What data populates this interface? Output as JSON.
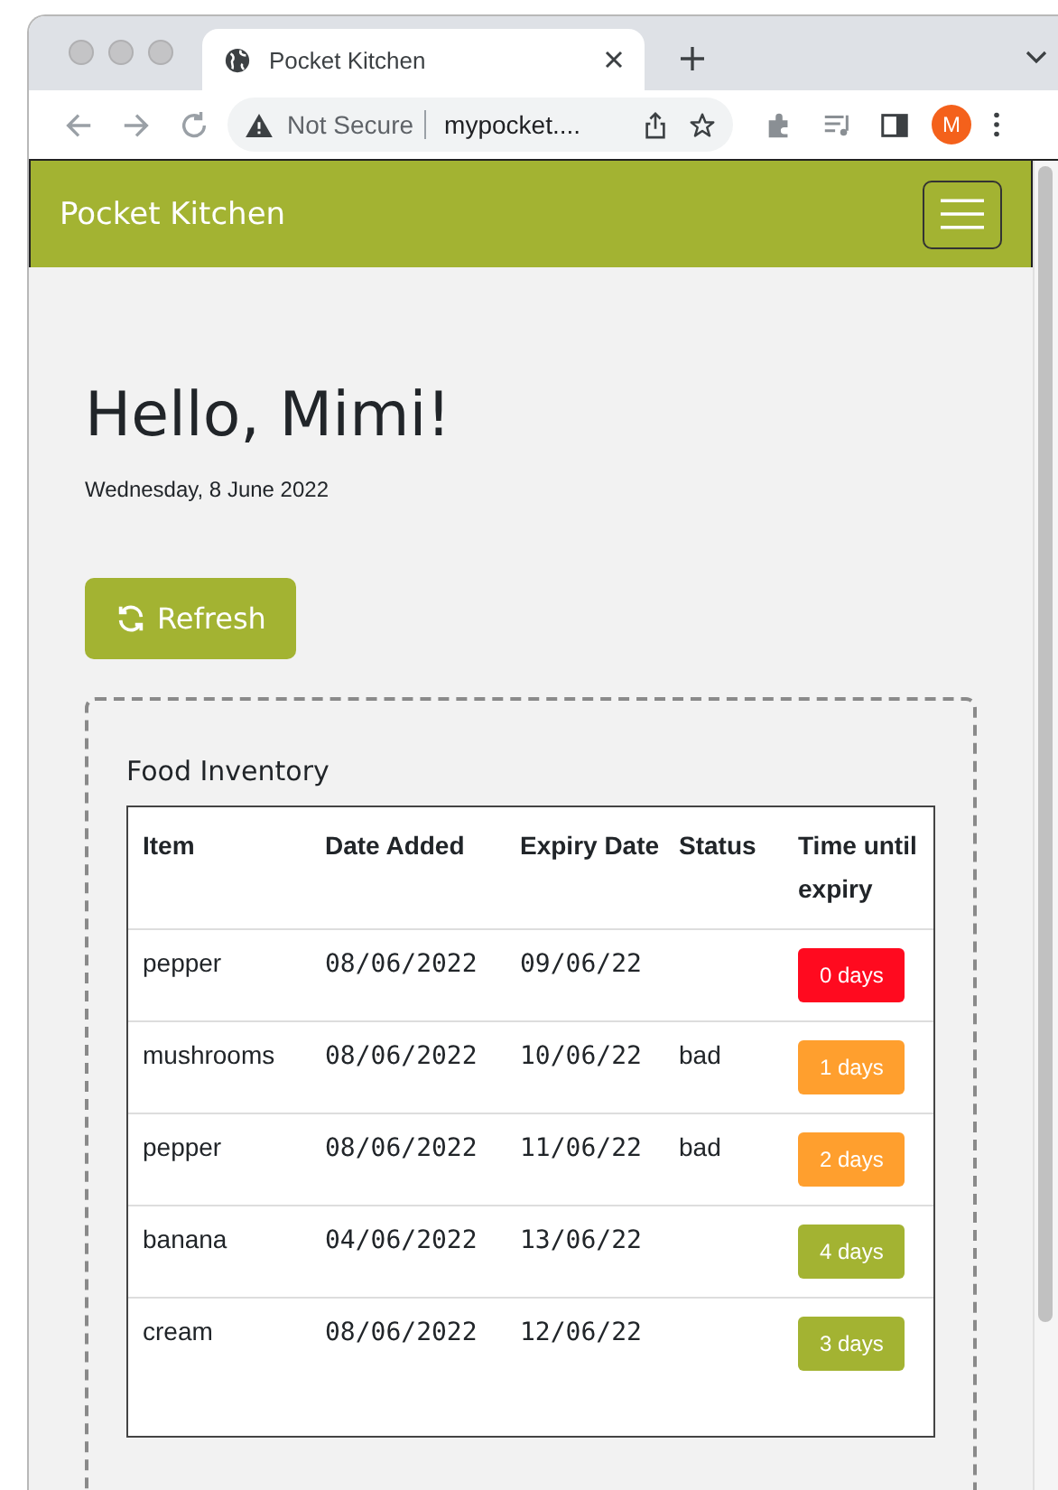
{
  "browser": {
    "tab_title": "Pocket Kitchen",
    "security_label": "Not Secure",
    "url": "mypocket....",
    "profile_initial": "M"
  },
  "navbar": {
    "brand": "Pocket Kitchen"
  },
  "greeting": "Hello, Mimi!",
  "date": "Wednesday, 8 June 2022",
  "refresh_button": "Refresh",
  "inventory": {
    "title": "Food Inventory",
    "columns": [
      "Item",
      "Date Added",
      "Expiry Date",
      "Status",
      "Time until expiry"
    ],
    "rows": [
      {
        "item": "pepper",
        "date_added": "08/06/2022",
        "expiry_date": "09/06/22",
        "status": "",
        "time_left": "0 days",
        "color": "#ff0a1f"
      },
      {
        "item": "mushrooms",
        "date_added": "08/06/2022",
        "expiry_date": "10/06/22",
        "status": "bad",
        "time_left": "1 days",
        "color": "#ff9f2e"
      },
      {
        "item": "pepper",
        "date_added": "08/06/2022",
        "expiry_date": "11/06/22",
        "status": "bad",
        "time_left": "2 days",
        "color": "#ff9f2e"
      },
      {
        "item": "banana",
        "date_added": "04/06/2022",
        "expiry_date": "13/06/22",
        "status": "",
        "time_left": "4 days",
        "color": "#a3b332"
      },
      {
        "item": "cream",
        "date_added": "08/06/2022",
        "expiry_date": "12/06/22",
        "status": "",
        "time_left": "3 days",
        "color": "#a3b332"
      }
    ]
  }
}
